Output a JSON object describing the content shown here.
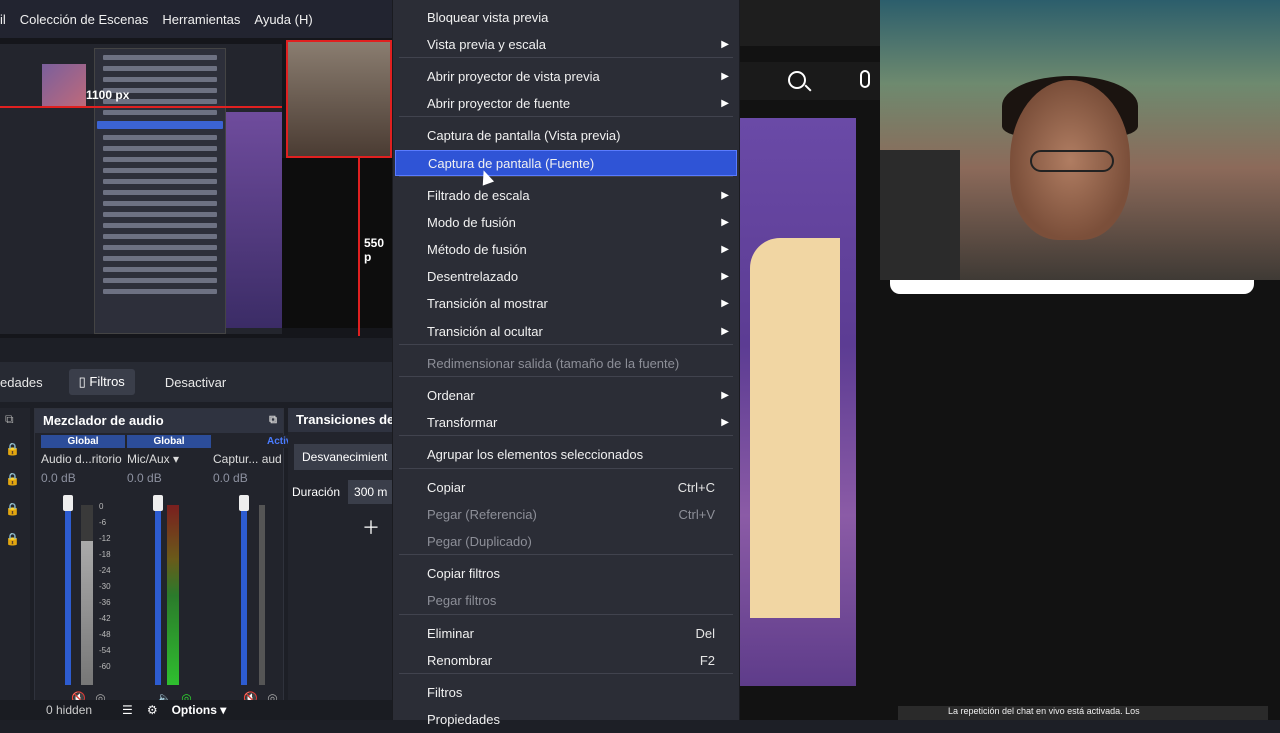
{
  "menubar": {
    "items": [
      "rfil",
      "Colección de Escenas",
      "Herramientas",
      "Ayuda (H)"
    ]
  },
  "preview": {
    "label_width": "1100 px",
    "label_height": "550 p"
  },
  "tabs": {
    "properties": "edades",
    "filters": "Filtros",
    "deactivate": "Desactivar"
  },
  "mixer": {
    "title": "Mezclador de audio",
    "channels": [
      {
        "header": "Global",
        "name": "Audio d...ritorio",
        "db": "0.0 dB"
      },
      {
        "header": "Global",
        "name": "Mic/Aux",
        "db": "0.0 dB"
      },
      {
        "header": "Active",
        "name": "Captur... aud",
        "db": "0.0 dB"
      }
    ],
    "scale": [
      "0",
      "-6",
      "-12",
      "-18",
      "-24",
      "-30",
      "-36",
      "-42",
      "-48",
      "-54",
      "-60"
    ]
  },
  "transitions": {
    "title": "Transiciones de",
    "type": "Desvanecimient",
    "duration_label": "Duración",
    "duration_value": "300 m"
  },
  "footer": {
    "hidden": "0 hidden",
    "options": "Options"
  },
  "context_menu": {
    "items": [
      {
        "label": "Bloquear vista previa",
        "arrow": false
      },
      {
        "label": "Vista previa y escala",
        "arrow": true
      },
      {
        "label": "Abrir proyector de vista previa",
        "arrow": true
      },
      {
        "label": "Abrir proyector de fuente",
        "arrow": true
      },
      {
        "label": "Captura de pantalla (Vista previa)",
        "arrow": false
      },
      {
        "label": "Captura de pantalla (Fuente)",
        "arrow": false,
        "selected": true
      },
      {
        "label": "Filtrado de escala",
        "arrow": true
      },
      {
        "label": "Modo de fusión",
        "arrow": true
      },
      {
        "label": "Método de fusión",
        "arrow": true
      },
      {
        "label": "Desentrelazado",
        "arrow": true
      },
      {
        "label": "Transición al mostrar",
        "arrow": true
      },
      {
        "label": "Transición al ocultar",
        "arrow": true
      },
      {
        "label": "Redimensionar salida (tamaño de la fuente)",
        "disabled": true
      },
      {
        "label": "Ordenar",
        "arrow": true
      },
      {
        "label": "Transformar",
        "arrow": true
      },
      {
        "label": "Agrupar los elementos seleccionados"
      },
      {
        "label": "Copiar",
        "shortcut": "Ctrl+C"
      },
      {
        "label": "Pegar (Referencia)",
        "shortcut": "Ctrl+V",
        "disabled": true
      },
      {
        "label": "Pegar (Duplicado)",
        "disabled": true
      },
      {
        "label": "Copiar filtros"
      },
      {
        "label": "Pegar filtros",
        "disabled": true
      },
      {
        "label": "Eliminar",
        "shortcut": "Del"
      },
      {
        "label": "Renombrar",
        "shortcut": "F2"
      },
      {
        "label": "Filtros"
      },
      {
        "label": "Propiedades"
      }
    ]
  },
  "stream": {
    "toast": "La repetición del chat en vivo está activada. Los"
  },
  "colors": {
    "selection": "#2f54d6",
    "menu_bg": "#2b2d36",
    "accent_red": "#e02020"
  }
}
